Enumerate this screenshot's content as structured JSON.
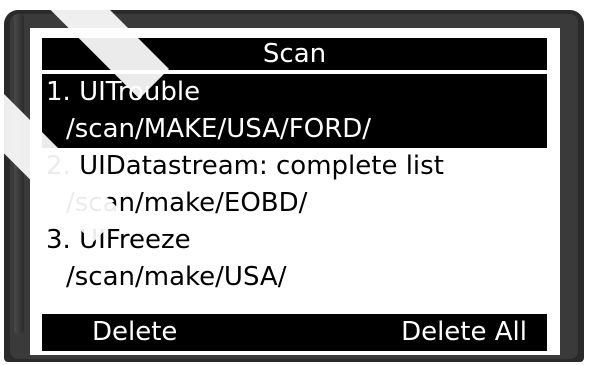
{
  "screen": {
    "title": "Scan"
  },
  "list": {
    "items": [
      {
        "number": "1.",
        "name": "UITrouble",
        "path": "/scan/MAKE/USA/FORD/",
        "selected": true
      },
      {
        "number": "2.",
        "name": "UIDatastream: complete list",
        "path": "/scan/make/EOBD/",
        "selected": false
      },
      {
        "number": "3.",
        "name": "UIFreeze",
        "path": "/scan/make/USA/",
        "selected": false
      }
    ]
  },
  "footer": {
    "delete_label": "Delete",
    "delete_all_label": "Delete All"
  },
  "colors": {
    "bezel": "#2a2a2a",
    "screen_bg": "#ffffff",
    "highlight_bg": "#000000",
    "highlight_fg": "#ffffff"
  }
}
